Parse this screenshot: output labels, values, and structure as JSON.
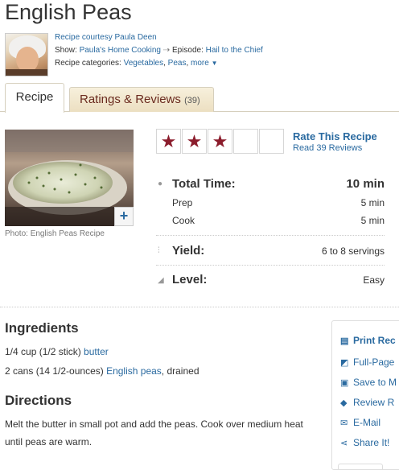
{
  "recipe": {
    "title": "English Peas",
    "courtesy": "Recipe courtesy Paula Deen",
    "show_label": "Show:",
    "show_name": "Paula's Home Cooking",
    "episode_label": "Episode:",
    "episode_name": "Hail to the Chief",
    "categories_label": "Recipe categories:",
    "categories": [
      "Vegetables",
      "Peas"
    ],
    "more_label": "more"
  },
  "tabs": [
    {
      "label": "Recipe",
      "active": true
    },
    {
      "label": "Ratings & Reviews",
      "count": "(39)",
      "active": false
    }
  ],
  "photo": {
    "caption": "Photo: English Peas Recipe",
    "plus_label": "+"
  },
  "rating": {
    "filled_stars": 3,
    "total_stars": 5,
    "rate_label": "Rate This Recipe",
    "read_label": "Read 39 Reviews"
  },
  "times": {
    "total_label": "Total Time:",
    "total_value": "10 min",
    "prep_label": "Prep",
    "prep_value": "5 min",
    "cook_label": "Cook",
    "cook_value": "5 min",
    "yield_label": "Yield:",
    "yield_value": "6 to 8 servings",
    "level_label": "Level:",
    "level_value": "Easy"
  },
  "ingredients": {
    "heading": "Ingredients",
    "items": [
      {
        "prefix": "1/4 cup (1/2 stick) ",
        "link": "butter",
        "suffix": ""
      },
      {
        "prefix": "2 cans (14 1/2-ounces) ",
        "link": "English peas",
        "suffix": ", drained"
      }
    ]
  },
  "directions": {
    "heading": "Directions",
    "text": "Melt the butter in small pot and add the peas. Cook over medium heat until peas are warm."
  },
  "sidebar": {
    "items": [
      {
        "icon": "print-icon",
        "label": "Print Rec"
      },
      {
        "icon": "fullpage-icon",
        "label": "Full-Page"
      },
      {
        "icon": "save-icon",
        "label": "Save to M"
      },
      {
        "icon": "review-icon",
        "label": "Review R"
      },
      {
        "icon": "email-icon",
        "label": "E-Mail"
      },
      {
        "icon": "share-icon",
        "label": "Share It!"
      }
    ]
  },
  "colors": {
    "link": "#2a6aa0",
    "star": "#8b1c2c",
    "tab_inactive_text": "#6a2a1e"
  }
}
